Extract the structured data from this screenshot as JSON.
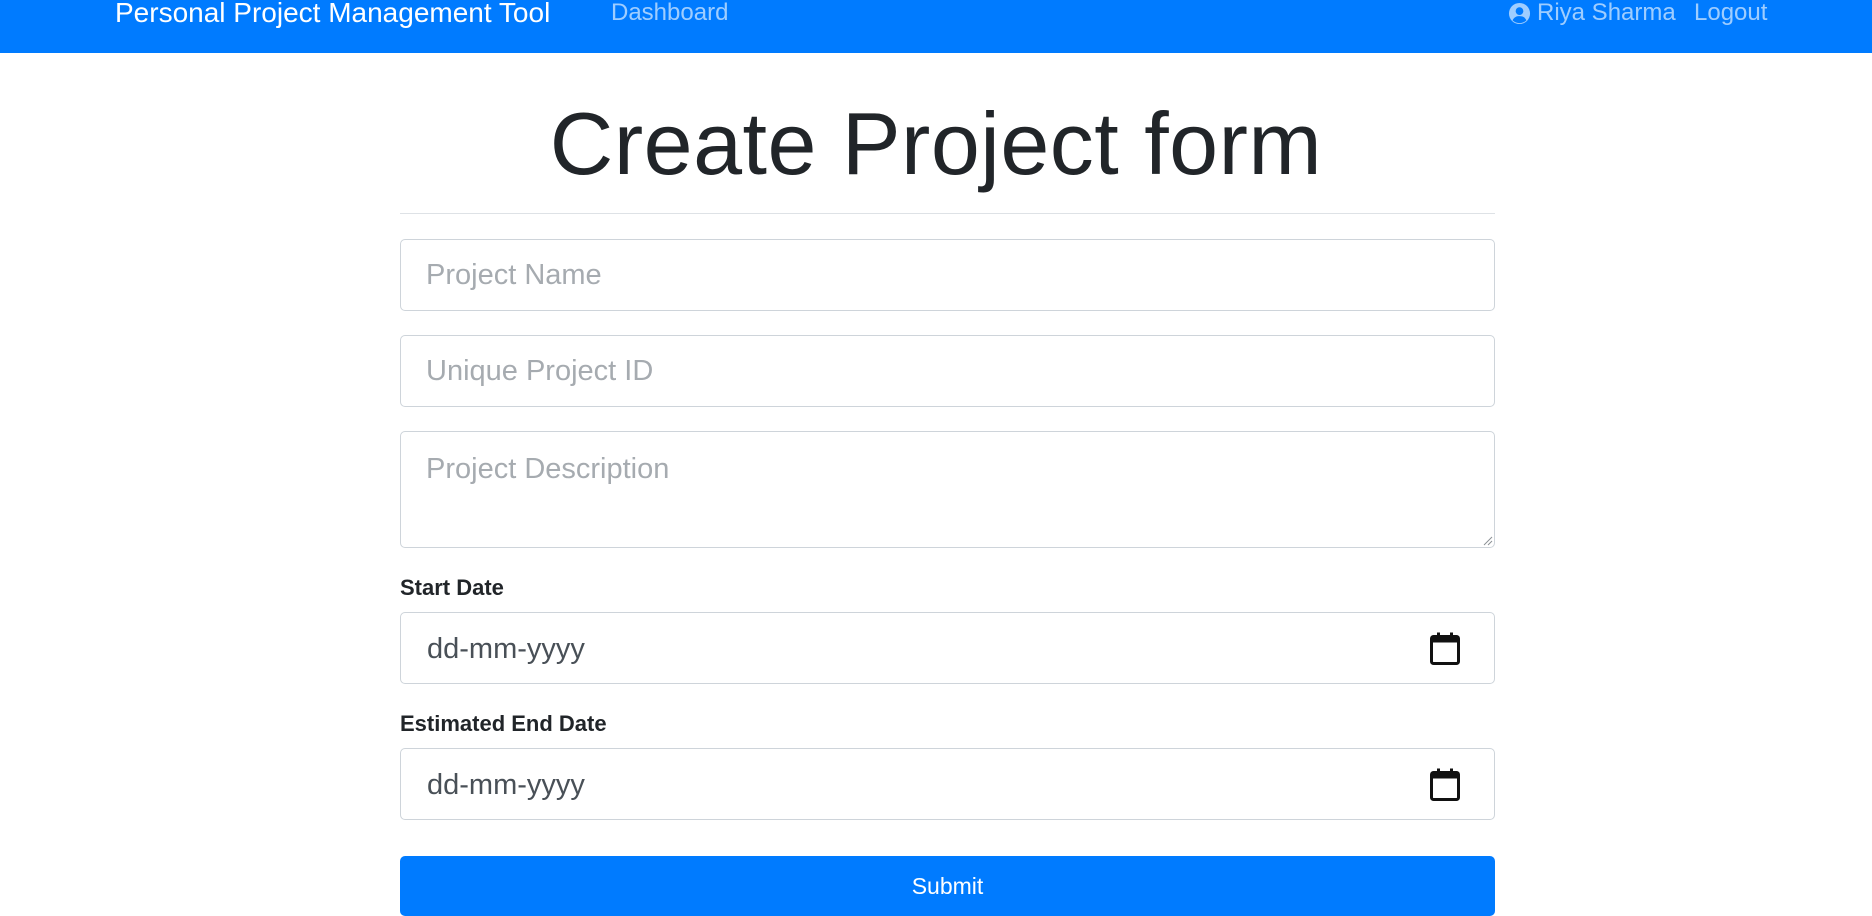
{
  "navbar": {
    "brand": "Personal Project Management Tool",
    "dashboard_label": "Dashboard",
    "user_name": "Riya Sharma",
    "logout_label": "Logout",
    "bg_color": "#007bff",
    "user_icon": "user-circle-icon"
  },
  "page": {
    "title": "Create Project form"
  },
  "form": {
    "project_name_placeholder": "Project Name",
    "project_id_placeholder": "Unique Project ID",
    "project_description_placeholder": "Project Description",
    "start_date_label": "Start Date",
    "start_date_value": "dd-mm-yyyy",
    "end_date_label": "Estimated End Date",
    "end_date_value": "dd-mm-yyyy",
    "calendar_icon": "calendar-icon",
    "submit_label": "Submit"
  }
}
